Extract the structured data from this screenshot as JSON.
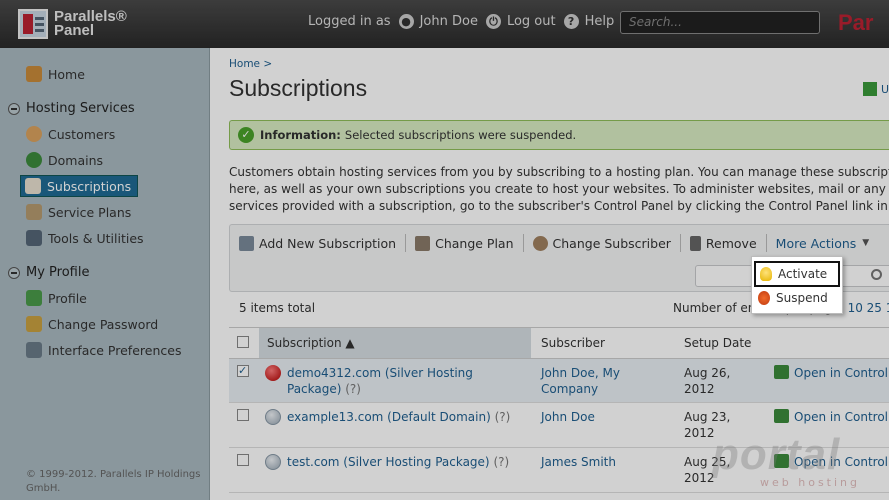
{
  "header": {
    "logo_line1": "Parallels®",
    "logo_line2": "Panel",
    "logged_in_label": "Logged in as",
    "user_name": "John Doe",
    "logout_label": "Log out",
    "help_label": "Help",
    "search_placeholder": "Search...",
    "brand_right": "Par"
  },
  "sidebar": {
    "home": "Home",
    "hosting_services": "Hosting Services",
    "customers": "Customers",
    "domains": "Domains",
    "subscriptions": "Subscriptions",
    "service_plans": "Service Plans",
    "tools_utilities": "Tools & Utilities",
    "my_profile": "My Profile",
    "profile": "Profile",
    "change_password": "Change Password",
    "interface_preferences": "Interface Preferences",
    "footer_line1": "© 1999-2012. Parallels IP Holdings",
    "footer_line2": "GmbH."
  },
  "main": {
    "breadcrumb": "Home >",
    "title": "Subscriptions",
    "upgrade_label": "U",
    "info_label": "Information:",
    "info_text": "Selected subscriptions were suspended.",
    "desc_line1": "Customers obtain hosting services from you by subscribing to a hosting plan. You can manage these subscription",
    "desc_line2": "here, as well as your own subscriptions you create to host your websites. To administer websites, mail or any ot",
    "desc_line3": "services provided with a subscription, go to the subscriber's Control Panel by clicking the Control Panel link in th"
  },
  "toolbar": {
    "add_new": "Add New Subscription",
    "change_plan": "Change Plan",
    "change_subscriber": "Change Subscriber",
    "remove": "Remove",
    "more_actions": "More Actions"
  },
  "dropdown": {
    "activate": "Activate",
    "suspend": "Suspend"
  },
  "list": {
    "items_total": "5 items total",
    "per_page_label": "Number of entries per page:",
    "per_page_options": "10 25 1"
  },
  "table": {
    "col_subscription": "Subscription",
    "col_subscriber": "Subscriber",
    "col_setup_date": "Setup Date",
    "rows": [
      {
        "name": "demo4312.com (Silver Hosting",
        "name2": "Package)",
        "hint": "(?)",
        "subscriber": "John Doe, My",
        "subscriber2": "Company",
        "date": "Aug 26,",
        "date2": "2012",
        "action": "Open in Control"
      },
      {
        "name": "example13.com (Default Domain)",
        "name2": "",
        "hint": "(?)",
        "subscriber": "John Doe",
        "subscriber2": "",
        "date": "Aug 23,",
        "date2": "2012",
        "action": "Open in Control"
      },
      {
        "name": "test.com (Silver Hosting Package)",
        "name2": "",
        "hint": "(?)",
        "subscriber": "James Smith",
        "subscriber2": "",
        "date": "Aug 25,",
        "date2": "2012",
        "action": "Open in Control"
      }
    ]
  },
  "watermark": {
    "text": "portal",
    "sub": "web hosting"
  }
}
